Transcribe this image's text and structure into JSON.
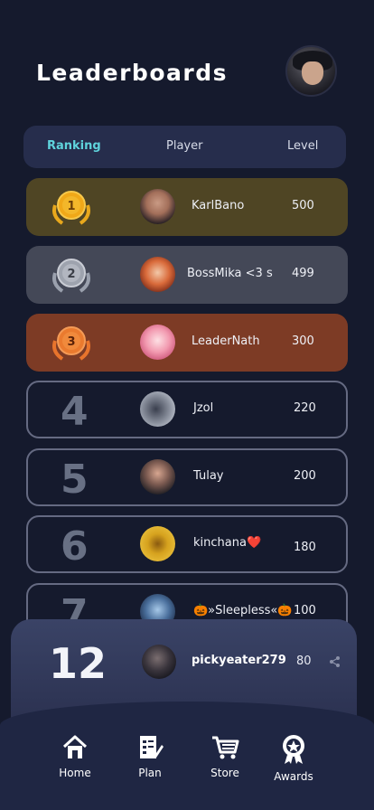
{
  "header": {
    "title": "Leaderboards"
  },
  "table_header": {
    "ranking": "Ranking",
    "player": "Player",
    "level": "Level"
  },
  "rows": [
    {
      "rank": "1",
      "medal": "gold-medal",
      "name": "KarlBano",
      "level": "500"
    },
    {
      "rank": "2",
      "medal": "silver-medal",
      "name": "BossMika <3 s",
      "level": "499"
    },
    {
      "rank": "3",
      "medal": "bronze-medal",
      "name": "LeaderNath",
      "level": "300"
    },
    {
      "rank": "4",
      "name": "Jzol",
      "level": "220"
    },
    {
      "rank": "5",
      "name": "Tulay",
      "level": "200"
    },
    {
      "rank": "6",
      "name": "kinchana❤️",
      "level": "180"
    },
    {
      "rank": "7",
      "name": "🎃»Sleepless«🎃",
      "level": "100"
    }
  ],
  "me": {
    "rank": "12",
    "name": "pickyeater279",
    "level": "80"
  },
  "nav": [
    {
      "label": "Home",
      "icon": "home-icon"
    },
    {
      "label": "Plan",
      "icon": "plan-icon"
    },
    {
      "label": "Store",
      "icon": "cart-icon"
    },
    {
      "label": "Awards",
      "icon": "award-icon"
    }
  ],
  "colors": {
    "accent": "#5fd3dc",
    "gold": "#4f4524",
    "silver": "#444857",
    "bronze": "#7d3b25",
    "background": "#151a2d"
  }
}
